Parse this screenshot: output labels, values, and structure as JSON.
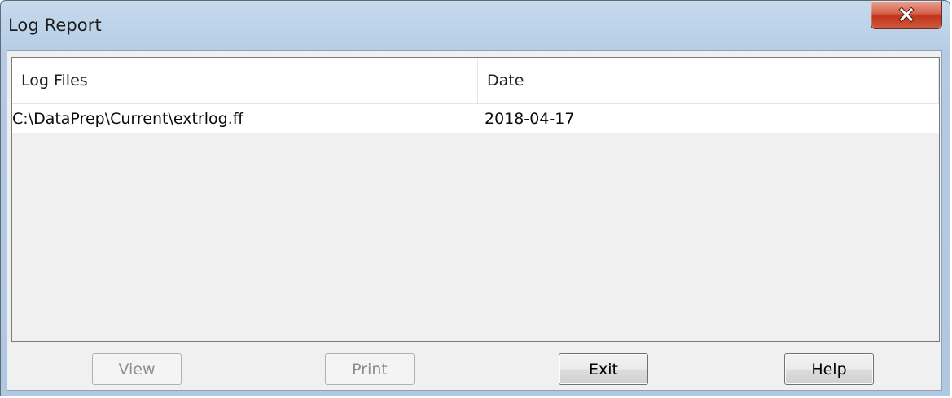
{
  "window": {
    "title": "Log Report"
  },
  "list": {
    "columns": [
      "Log Files",
      "Date"
    ],
    "rows": [
      {
        "file": "C:\\DataPrep\\Current\\extrlog.ff",
        "date": "2018-04-17"
      }
    ]
  },
  "buttons": {
    "view": "View",
    "print": "Print",
    "exit": "Exit",
    "help": "Help"
  },
  "icons": {
    "close": "close-icon"
  },
  "colors": {
    "close_button": "#c7442a",
    "titlebar": "#bcd2e8",
    "client": "#f0f0f0"
  }
}
